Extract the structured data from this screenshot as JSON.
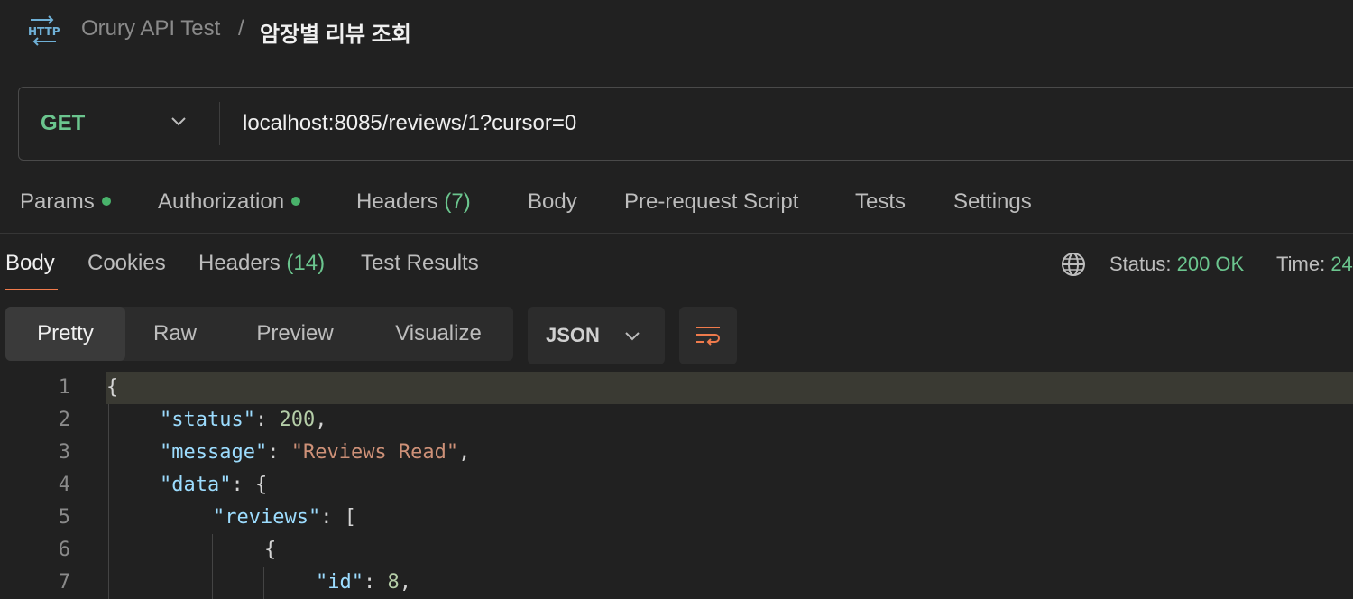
{
  "header": {
    "collection": "Orury API Test",
    "separator": "/",
    "request_name": "암장별 리뷰 조회"
  },
  "request": {
    "method": "GET",
    "url": "localhost:8085/reviews/1?cursor=0"
  },
  "request_tabs": [
    {
      "label": "Params",
      "has_dot": true
    },
    {
      "label": "Authorization",
      "has_dot": true
    },
    {
      "label": "Headers",
      "count": "(7)"
    },
    {
      "label": "Body"
    },
    {
      "label": "Pre-request Script"
    },
    {
      "label": "Tests"
    },
    {
      "label": "Settings"
    }
  ],
  "response_tabs": [
    {
      "label": "Body",
      "active": true
    },
    {
      "label": "Cookies"
    },
    {
      "label": "Headers",
      "count": "(14)"
    },
    {
      "label": "Test Results"
    }
  ],
  "status": {
    "label": "Status:",
    "value": "200 OK",
    "time_label": "Time:",
    "time_value": "24"
  },
  "format_tabs": [
    "Pretty",
    "Raw",
    "Preview",
    "Visualize"
  ],
  "active_format": "Pretty",
  "language": "JSON",
  "code_lines": [
    {
      "n": "1",
      "text": "{"
    },
    {
      "n": "2",
      "key": "\"status\"",
      "sep": ": ",
      "num": "200",
      "tail": ","
    },
    {
      "n": "3",
      "key": "\"message\"",
      "sep": ": ",
      "str": "\"Reviews Read\"",
      "tail": ","
    },
    {
      "n": "4",
      "key": "\"data\"",
      "sep": ": ",
      "tail": "{"
    },
    {
      "n": "5",
      "key": "\"reviews\"",
      "sep": ": ",
      "tail": "["
    },
    {
      "n": "6",
      "text": "{"
    },
    {
      "n": "7",
      "key": "\"id\"",
      "sep": ": ",
      "num": "8",
      "tail": ","
    }
  ],
  "colors": {
    "accent": "#f07b4c",
    "success": "#6bc58e",
    "background": "#212121"
  },
  "icons": [
    "http-icon",
    "chevron-down-icon",
    "globe-icon",
    "wrap-lines-icon"
  ]
}
